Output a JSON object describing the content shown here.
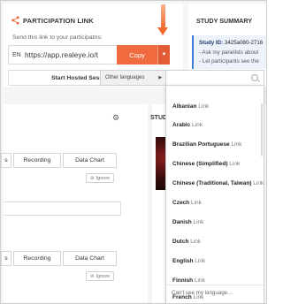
{
  "participation": {
    "title": "PARTICIPATION LINK",
    "description": "Send this link to your participatns:",
    "language_code": "EN",
    "url": "https://app.realeye.io/t",
    "copy_label": "Copy",
    "hosted_session_label": "Start Hosted Sess"
  },
  "summary": {
    "title": "STUDY SUMMARY",
    "id_label": "Study ID:",
    "id_value": "3425a080-2716",
    "lines": [
      "- Ask my panelists about",
      "- Let participants see the"
    ]
  },
  "studio_label": "STUD",
  "tabs_top": [
    "s",
    "Recording",
    "Data Chart"
  ],
  "tabs_bottom": [
    "s",
    "Recording",
    "Data Chart"
  ],
  "ignore_label": "Ignore",
  "menu": {
    "other_languages_label": "Other languages",
    "languages": [
      {
        "name": "Albanian",
        "suffix": "Link"
      },
      {
        "name": "Arabic",
        "suffix": "Link"
      },
      {
        "name": "Brazilian Portuguese",
        "suffix": "Link"
      },
      {
        "name": "Chinese (Simplified)",
        "suffix": "Link"
      },
      {
        "name": "Chinese (Traditional, Taiwan)",
        "suffix": "Link"
      },
      {
        "name": "Czech",
        "suffix": "Link"
      },
      {
        "name": "Danish",
        "suffix": "Link"
      },
      {
        "name": "Dutch",
        "suffix": "Link"
      },
      {
        "name": "English",
        "suffix": "Link"
      },
      {
        "name": "Finnish",
        "suffix": "Link"
      },
      {
        "name": "French",
        "suffix": "Link"
      }
    ],
    "cant_see_label": "Can't see my language..."
  },
  "colors": {
    "accent": "#f06a40",
    "accent_dark": "#e15c34",
    "summary_border": "#3e7bd6"
  }
}
